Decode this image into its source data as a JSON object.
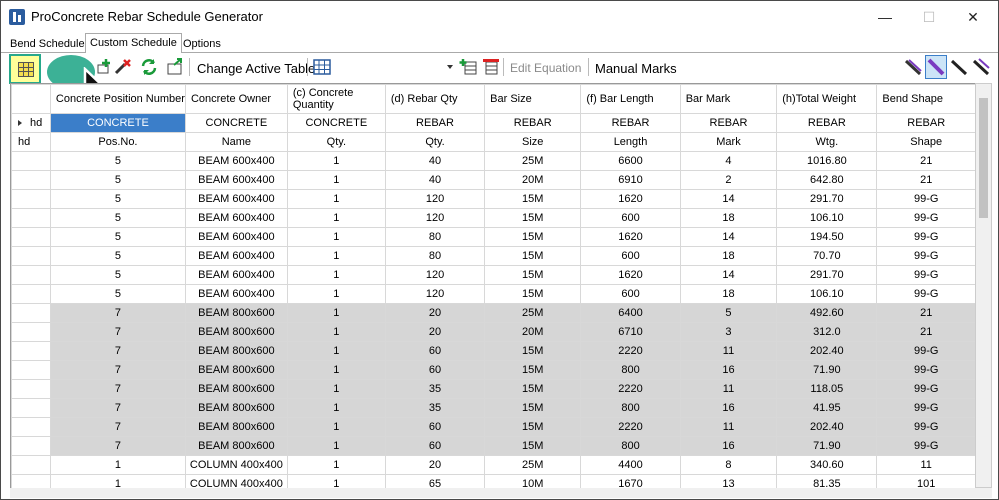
{
  "window": {
    "title": "ProConcrete Rebar Schedule Generator",
    "minimize": "—",
    "maximize": "☐",
    "close": "✕"
  },
  "tabs": [
    "Bend Schedule",
    "Custom Schedule",
    "Options"
  ],
  "toolbar": {
    "change_active_table": "Change Active Table",
    "edit_equation": "Edit Equation",
    "manual_marks": "Manual Marks"
  },
  "columns": [
    "Concrete Position Number",
    "Concrete Owner",
    "(c) Concrete Quantity",
    "(d) Rebar Qty",
    "Bar Size",
    "(f) Bar Length",
    "Bar Mark",
    "(h)Total Weight",
    "Bend Shape"
  ],
  "header_rows": [
    {
      "label": "hd",
      "cells": [
        "CONCRETE",
        "CONCRETE",
        "CONCRETE",
        "REBAR",
        "REBAR",
        "REBAR",
        "REBAR",
        "REBAR",
        "REBAR"
      ]
    },
    {
      "label": "hd",
      "cells": [
        "Pos.No.",
        "Name",
        "Qty.",
        "Qty.",
        "Size",
        "Length",
        "Mark",
        "Wtg.",
        "Shape"
      ]
    }
  ],
  "rows": [
    {
      "group": "white",
      "cells": [
        "5",
        "BEAM 600x400",
        "1",
        "40",
        "25M",
        "6600",
        "4",
        "1016.80",
        "21"
      ]
    },
    {
      "group": "white",
      "cells": [
        "5",
        "BEAM 600x400",
        "1",
        "40",
        "20M",
        "6910",
        "2",
        "642.80",
        "21"
      ]
    },
    {
      "group": "white",
      "cells": [
        "5",
        "BEAM 600x400",
        "1",
        "120",
        "15M",
        "1620",
        "14",
        "291.70",
        "99-G"
      ]
    },
    {
      "group": "white",
      "cells": [
        "5",
        "BEAM 600x400",
        "1",
        "120",
        "15M",
        "600",
        "18",
        "106.10",
        "99-G"
      ]
    },
    {
      "group": "white",
      "cells": [
        "5",
        "BEAM 600x400",
        "1",
        "80",
        "15M",
        "1620",
        "14",
        "194.50",
        "99-G"
      ]
    },
    {
      "group": "white",
      "cells": [
        "5",
        "BEAM 600x400",
        "1",
        "80",
        "15M",
        "600",
        "18",
        "70.70",
        "99-G"
      ]
    },
    {
      "group": "white",
      "cells": [
        "5",
        "BEAM 600x400",
        "1",
        "120",
        "15M",
        "1620",
        "14",
        "291.70",
        "99-G"
      ]
    },
    {
      "group": "white",
      "cells": [
        "5",
        "BEAM 600x400",
        "1",
        "120",
        "15M",
        "600",
        "18",
        "106.10",
        "99-G"
      ]
    },
    {
      "group": "gray",
      "cells": [
        "7",
        "BEAM 800x600",
        "1",
        "20",
        "25M",
        "6400",
        "5",
        "492.60",
        "21"
      ]
    },
    {
      "group": "gray",
      "cells": [
        "7",
        "BEAM 800x600",
        "1",
        "20",
        "20M",
        "6710",
        "3",
        "312.0",
        "21"
      ]
    },
    {
      "group": "gray",
      "cells": [
        "7",
        "BEAM 800x600",
        "1",
        "60",
        "15M",
        "2220",
        "11",
        "202.40",
        "99-G"
      ]
    },
    {
      "group": "gray",
      "cells": [
        "7",
        "BEAM 800x600",
        "1",
        "60",
        "15M",
        "800",
        "16",
        "71.90",
        "99-G"
      ]
    },
    {
      "group": "gray",
      "cells": [
        "7",
        "BEAM 800x600",
        "1",
        "35",
        "15M",
        "2220",
        "11",
        "118.05",
        "99-G"
      ]
    },
    {
      "group": "gray",
      "cells": [
        "7",
        "BEAM 800x600",
        "1",
        "35",
        "15M",
        "800",
        "16",
        "41.95",
        "99-G"
      ]
    },
    {
      "group": "gray",
      "cells": [
        "7",
        "BEAM 800x600",
        "1",
        "60",
        "15M",
        "2220",
        "11",
        "202.40",
        "99-G"
      ]
    },
    {
      "group": "gray",
      "cells": [
        "7",
        "BEAM 800x600",
        "1",
        "60",
        "15M",
        "800",
        "16",
        "71.90",
        "99-G"
      ]
    },
    {
      "group": "white",
      "cells": [
        "1",
        "COLUMN 400x400",
        "1",
        "20",
        "25M",
        "4400",
        "8",
        "340.60",
        "11"
      ]
    },
    {
      "group": "white",
      "cells": [
        "1",
        "COLUMN 400x400",
        "1",
        "65",
        "10M",
        "1670",
        "13",
        "81.35",
        "101"
      ]
    }
  ],
  "colors": {
    "accent_teal": "#27a88b",
    "selection_blue": "#3b7ec9",
    "group_gray": "#d6d6d6"
  }
}
